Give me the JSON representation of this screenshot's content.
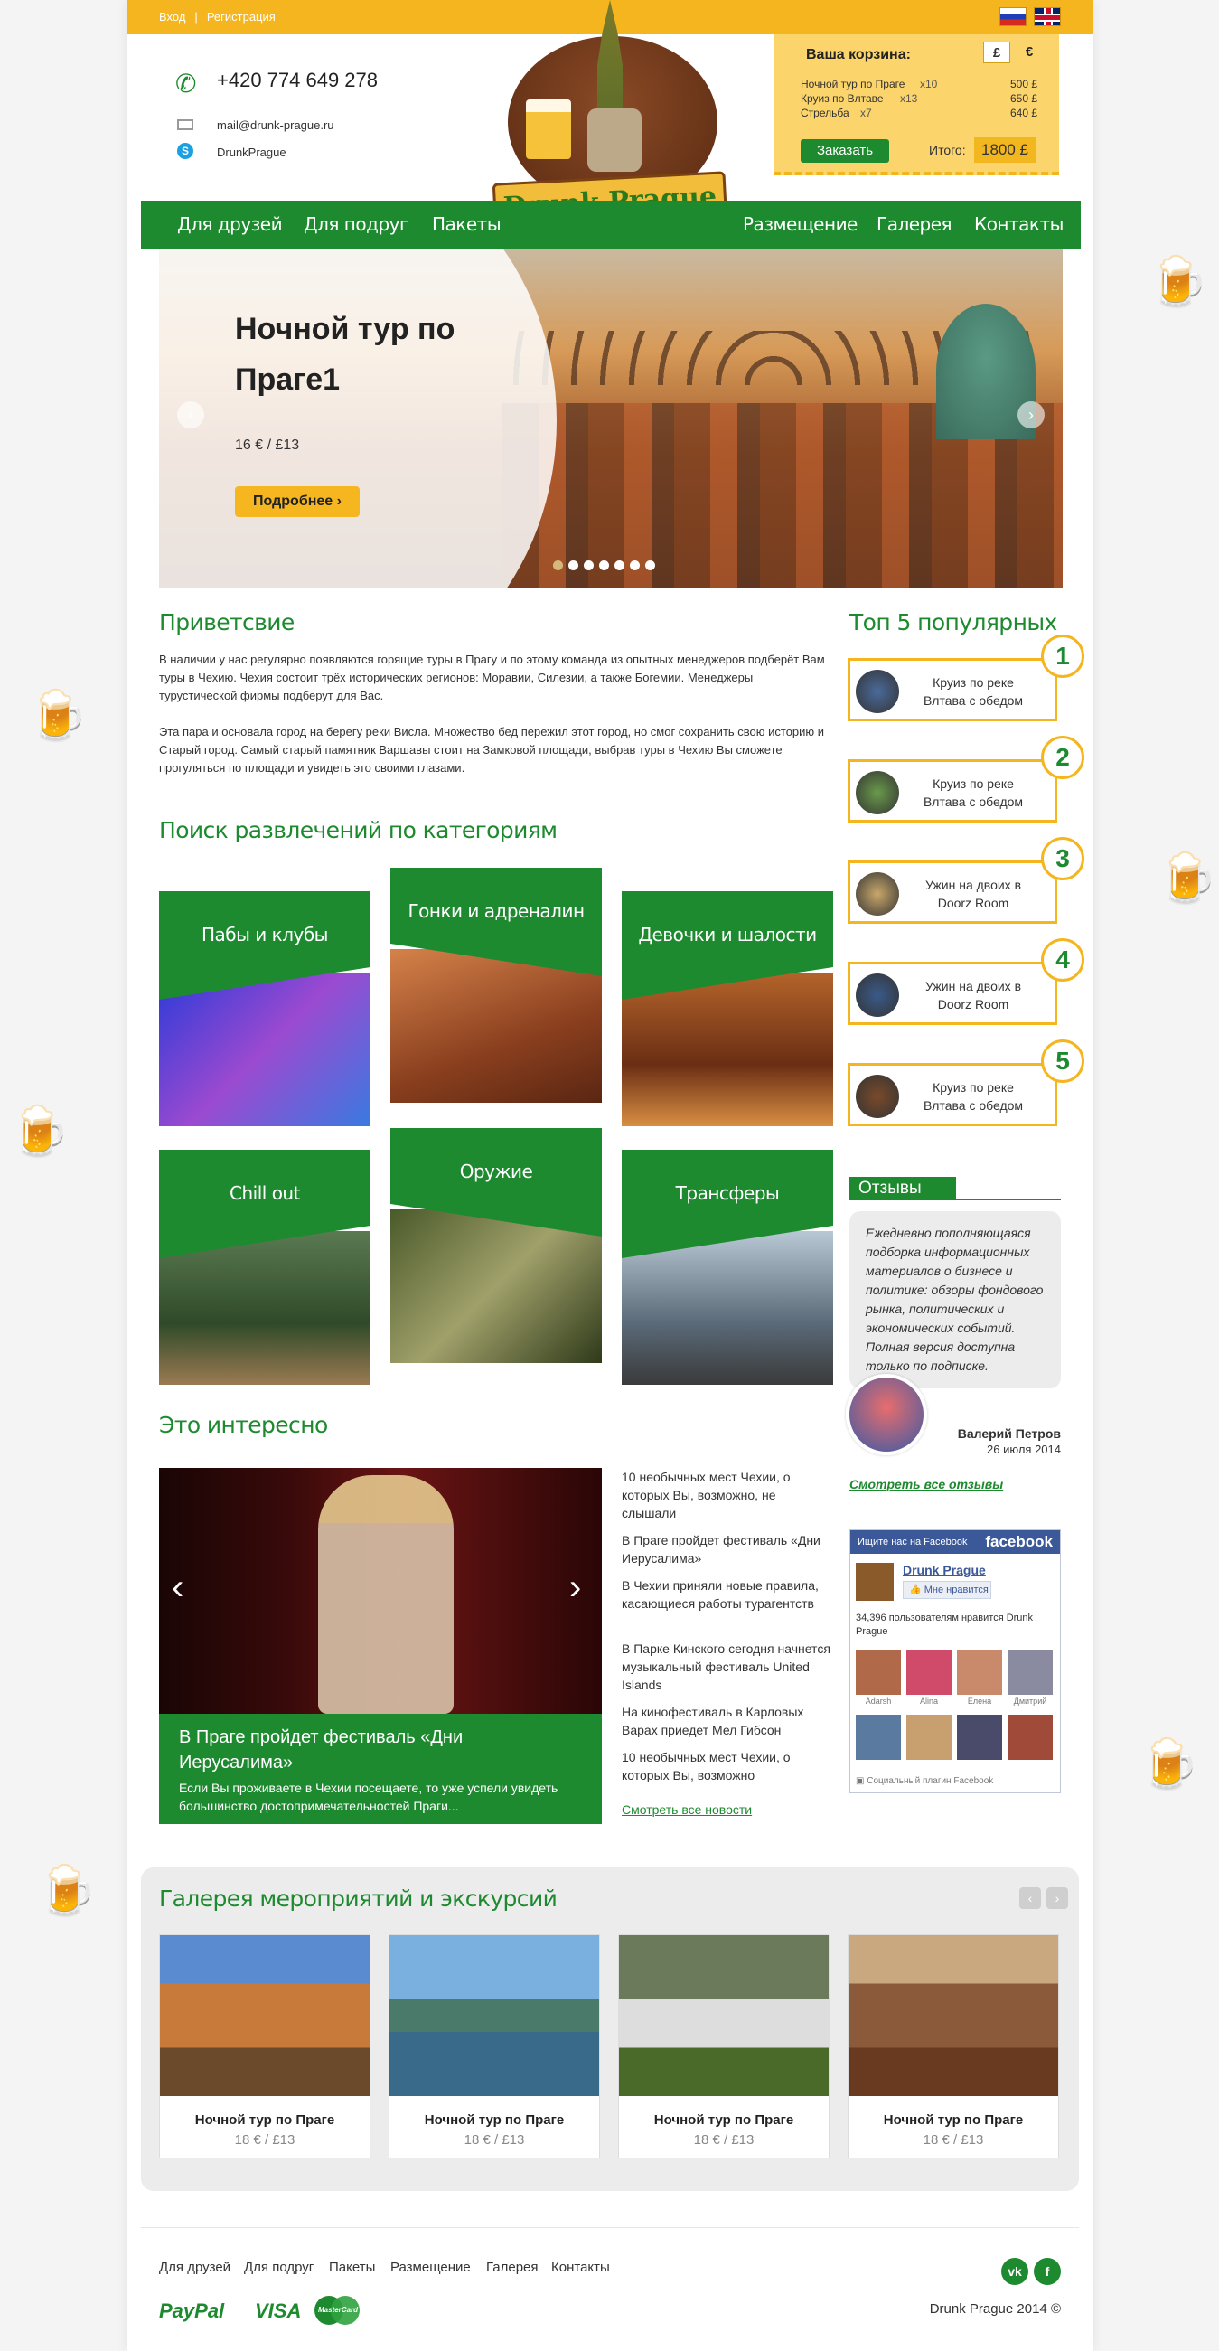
{
  "topbar": {
    "login": "Вход",
    "register": "Регистрация"
  },
  "contacts": {
    "phone": "+420 774 649 278",
    "email": "mail@drunk-prague.ru",
    "skype": "DrunkPrague"
  },
  "logo": {
    "text": "Drunk Prague"
  },
  "cart": {
    "title": "Ваша корзина:",
    "currencies": [
      "£",
      "€"
    ],
    "items": [
      {
        "name": "Ночной тур по Праге",
        "qty": "x10",
        "price": "500 £"
      },
      {
        "name": "Круиз по Влтаве",
        "qty": "x13",
        "price": "650 £"
      },
      {
        "name": "Стрельба",
        "qty": "x7",
        "price": "640 £"
      }
    ],
    "order_label": "Заказать",
    "total_label": "Итого:",
    "total": "1800 £"
  },
  "nav": {
    "items": [
      "Для друзей",
      "Для подруг",
      "Пакеты",
      "Размещение",
      "Галерея",
      "Контакты"
    ]
  },
  "slider": {
    "title": "Ночной тур по Праге1",
    "price": "16 € / £13",
    "button": "Подробнее",
    "dot_count": 7,
    "active_dot": 0
  },
  "welcome": {
    "heading": "Приветсвие",
    "p1": "В наличии у нас регулярно появляются горящие туры в Прагу и по этому команда из опытных менеджеров подберёт Вам туры в Чехию. Чехия состоит трёх исторических регионов: Моравии, Силезии, а также Богемии. Менеджеры турустической фирмы подберут для Вас.",
    "p2": "Эта пара и основала город на берегу реки Висла. Множество бед пережил этот город, но смог сохранить свою историю и Старый город. Самый старый памятник Варшавы стоит на Замковой площади, выбрав туры в Чехию Вы сможете прогуляться по площади и увидеть это своими глазами."
  },
  "categories": {
    "heading": "Поиск развлечений по категориям",
    "items": [
      "Пабы и клубы",
      "Гонки и адреналин",
      "Девочки и шалости",
      "Chill out",
      "Оружие",
      "Трансферы"
    ]
  },
  "top5": {
    "heading": "Топ 5 популярных",
    "items": [
      {
        "num": "1",
        "text": "Круиз по реке Влтава с обедом"
      },
      {
        "num": "2",
        "text": "Круиз по реке Влтава с обедом"
      },
      {
        "num": "3",
        "text": "Ужин на двоих в Doorz Room"
      },
      {
        "num": "4",
        "text": "Ужин на двоих в Doorz Room"
      },
      {
        "num": "5",
        "text": "Круиз по реке Влтава с обедом"
      }
    ]
  },
  "reviews": {
    "heading": "Отзывы",
    "text": "Ежедневно пополняющаяся подборка информационных материалов о бизнесе и политике: обзоры фондового рынка, политических и экономических событий. Полная версия доступна только по подписке.",
    "author": "Валерий Петров",
    "date": "26 июля 2014",
    "all_link": "Смотреть все отзывы"
  },
  "facebook": {
    "find_us": "Ищите нас на Facebook",
    "brand": "facebook",
    "page_name": "Drunk Prague",
    "like": "Мне нравится",
    "count_text": "34,396 пользователям нравится Drunk Prague",
    "faces": [
      "Adarsh",
      "Alina",
      "Елена",
      "Дмитрий",
      "",
      "",
      "",
      ""
    ],
    "footer": "Социальный плагин Facebook"
  },
  "news": {
    "heading": "Это интересно",
    "caption_title": "В Праге пройдет фестиваль «Дни Иерусалима»",
    "caption_text": "Если Вы проживаете в Чехии посещаете, то уже успели увидеть большинство достопримечательностей Праги...",
    "list": [
      "10 необычных мест Чехии, о которых Вы, возможно, не слышали",
      "В Праге пройдет фестиваль «Дни Иерусалима»",
      "В Чехии приняли новые правила, касающиеся работы турагентств",
      "В Парке Кинского сегодня начнется музыкальный фестиваль United Islands",
      "На кинофестиваль в Карловых Варах приедет Мел Гибсон",
      "10 необычных мест Чехии, о которых Вы, возможно"
    ],
    "all_link": "Смотреть все новости"
  },
  "gallery": {
    "heading": "Галерея мероприятий и экскурсий",
    "items": [
      {
        "title": "Ночной тур по Праге",
        "price": "18 € / £13"
      },
      {
        "title": "Ночной тур по Праге",
        "price": "18 € / £13"
      },
      {
        "title": "Ночной тур по Праге",
        "price": "18 € / £13"
      },
      {
        "title": "Ночной тур по Праге",
        "price": "18 € / £13"
      }
    ]
  },
  "footer": {
    "links": [
      "Для друзей",
      "Для подруг",
      "Пакеты",
      "Размещение",
      "Галерея",
      "Контакты"
    ],
    "social": [
      "vk",
      "f"
    ],
    "paypal": "PayPal",
    "visa": "VISA",
    "mastercard": "MasterCard",
    "copyright": "Drunk Prague 2014 ©"
  },
  "colors": {
    "green": "#1e8a2f",
    "yellow": "#f4b51e"
  }
}
